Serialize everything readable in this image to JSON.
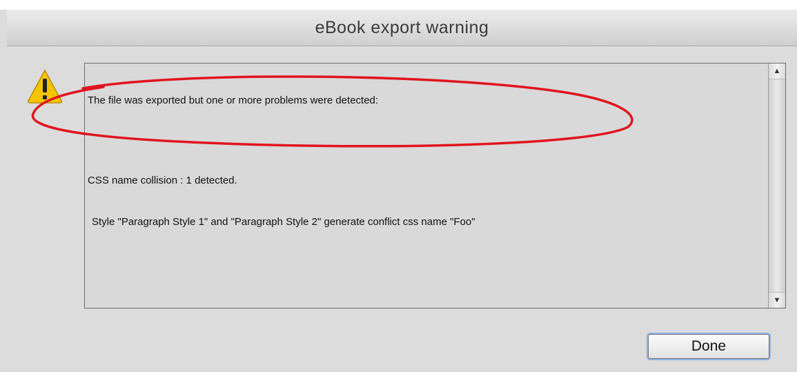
{
  "dialog": {
    "title": "eBook export warning",
    "icon": "warning-icon",
    "messages": {
      "intro": "The file was exported but one or more problems were detected:",
      "collision": "CSS name collision : 1 detected.",
      "detail": "Style \"Paragraph Style 1\" and \"Paragraph Style 2\" generate conflict css name \"Foo\""
    },
    "done_label": "Done",
    "annotation_color": "#e0141e",
    "warning_color": "#f5c400"
  }
}
